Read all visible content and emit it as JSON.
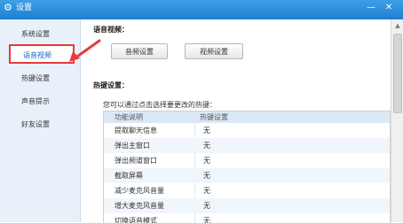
{
  "window": {
    "title": "设置",
    "icon": "gear-icon",
    "minimize_symbol": "—",
    "close_symbol": "✕",
    "accent_color": "#2b8ee0",
    "highlight_color": "#e43b3b"
  },
  "sidebar": {
    "items": [
      {
        "label": "系统设置"
      },
      {
        "label": "语音视频",
        "selected": true
      },
      {
        "label": "热键设置"
      },
      {
        "label": "声音提示"
      },
      {
        "label": "好友设置"
      }
    ]
  },
  "av_section": {
    "title": "语音视频：",
    "audio_button": "音频设置",
    "video_button": "视频设置"
  },
  "hotkey_section": {
    "title": "热键设置：",
    "hint": "您可以通过点击选择要更改的热键：",
    "columns": [
      "功能说明",
      "热键设置"
    ],
    "rows": [
      {
        "function": "提取聊天信息",
        "hotkey": "无"
      },
      {
        "function": "弹出主窗口",
        "hotkey": "无"
      },
      {
        "function": "弹出频道窗口",
        "hotkey": "无"
      },
      {
        "function": "截取屏幕",
        "hotkey": "无"
      },
      {
        "function": "减少麦克风音量",
        "hotkey": "无"
      },
      {
        "function": "增大麦克风音量",
        "hotkey": "无"
      },
      {
        "function": "切换语音模式",
        "hotkey": "无"
      }
    ]
  }
}
